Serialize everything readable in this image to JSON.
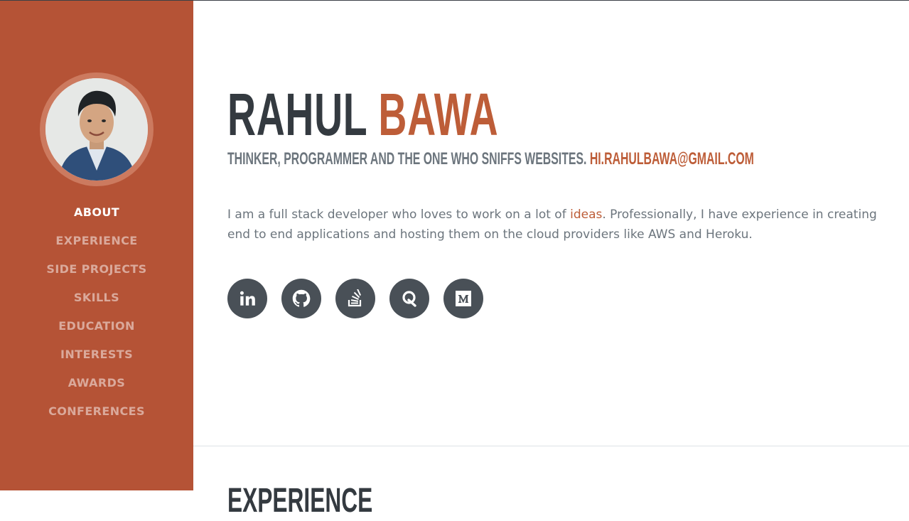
{
  "profile": {
    "first_name": "RAHUL",
    "last_name": "BAWA",
    "tagline": "THINKER, PROGRAMMER AND THE ONE WHO SNIFFS WEBSITES.",
    "email": "HI.RAHULBAWA@GMAIL.COM",
    "about_before": "I am a full stack developer who loves to work on a lot of ",
    "about_link": "ideas",
    "about_after": ". Professionally, I have experience in creating end to end applications and hosting them on the cloud providers like AWS and Heroku."
  },
  "nav": {
    "items": [
      {
        "label": "ABOUT"
      },
      {
        "label": "EXPERIENCE"
      },
      {
        "label": "SIDE PROJECTS"
      },
      {
        "label": "SKILLS"
      },
      {
        "label": "EDUCATION"
      },
      {
        "label": "INTERESTS"
      },
      {
        "label": "AWARDS"
      },
      {
        "label": "CONFERENCES"
      }
    ]
  },
  "social": [
    {
      "icon": "linkedin-icon"
    },
    {
      "icon": "github-icon"
    },
    {
      "icon": "stackoverflow-icon"
    },
    {
      "icon": "quora-icon"
    },
    {
      "icon": "medium-icon"
    }
  ],
  "next_section": {
    "title": "EXPERIENCE"
  },
  "colors": {
    "sidebar": "#b55336",
    "accent": "#bd5d38",
    "dark": "#343a40",
    "icon_bg": "#495057",
    "muted": "#6c757d"
  }
}
